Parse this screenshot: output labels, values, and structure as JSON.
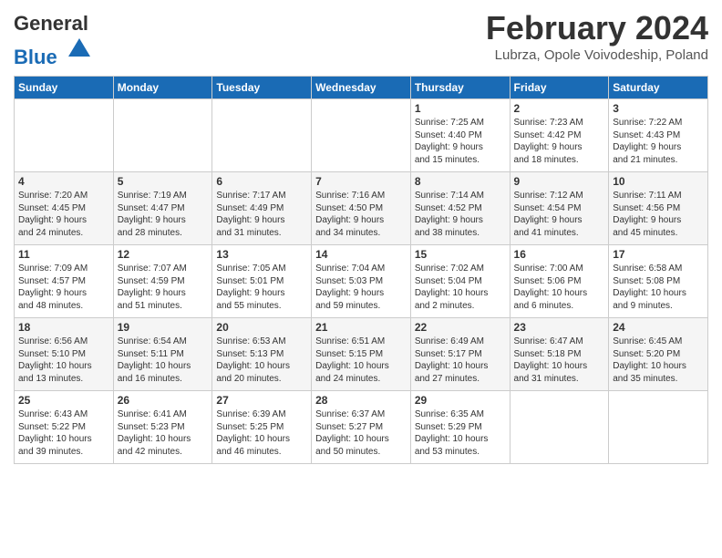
{
  "header": {
    "logo_general": "General",
    "logo_blue": "Blue",
    "month_title": "February 2024",
    "location": "Lubrza, Opole Voivodeship, Poland"
  },
  "weekdays": [
    "Sunday",
    "Monday",
    "Tuesday",
    "Wednesday",
    "Thursday",
    "Friday",
    "Saturday"
  ],
  "weeks": [
    [
      {
        "day": "",
        "content": ""
      },
      {
        "day": "",
        "content": ""
      },
      {
        "day": "",
        "content": ""
      },
      {
        "day": "",
        "content": ""
      },
      {
        "day": "1",
        "content": "Sunrise: 7:25 AM\nSunset: 4:40 PM\nDaylight: 9 hours\nand 15 minutes."
      },
      {
        "day": "2",
        "content": "Sunrise: 7:23 AM\nSunset: 4:42 PM\nDaylight: 9 hours\nand 18 minutes."
      },
      {
        "day": "3",
        "content": "Sunrise: 7:22 AM\nSunset: 4:43 PM\nDaylight: 9 hours\nand 21 minutes."
      }
    ],
    [
      {
        "day": "4",
        "content": "Sunrise: 7:20 AM\nSunset: 4:45 PM\nDaylight: 9 hours\nand 24 minutes."
      },
      {
        "day": "5",
        "content": "Sunrise: 7:19 AM\nSunset: 4:47 PM\nDaylight: 9 hours\nand 28 minutes."
      },
      {
        "day": "6",
        "content": "Sunrise: 7:17 AM\nSunset: 4:49 PM\nDaylight: 9 hours\nand 31 minutes."
      },
      {
        "day": "7",
        "content": "Sunrise: 7:16 AM\nSunset: 4:50 PM\nDaylight: 9 hours\nand 34 minutes."
      },
      {
        "day": "8",
        "content": "Sunrise: 7:14 AM\nSunset: 4:52 PM\nDaylight: 9 hours\nand 38 minutes."
      },
      {
        "day": "9",
        "content": "Sunrise: 7:12 AM\nSunset: 4:54 PM\nDaylight: 9 hours\nand 41 minutes."
      },
      {
        "day": "10",
        "content": "Sunrise: 7:11 AM\nSunset: 4:56 PM\nDaylight: 9 hours\nand 45 minutes."
      }
    ],
    [
      {
        "day": "11",
        "content": "Sunrise: 7:09 AM\nSunset: 4:57 PM\nDaylight: 9 hours\nand 48 minutes."
      },
      {
        "day": "12",
        "content": "Sunrise: 7:07 AM\nSunset: 4:59 PM\nDaylight: 9 hours\nand 51 minutes."
      },
      {
        "day": "13",
        "content": "Sunrise: 7:05 AM\nSunset: 5:01 PM\nDaylight: 9 hours\nand 55 minutes."
      },
      {
        "day": "14",
        "content": "Sunrise: 7:04 AM\nSunset: 5:03 PM\nDaylight: 9 hours\nand 59 minutes."
      },
      {
        "day": "15",
        "content": "Sunrise: 7:02 AM\nSunset: 5:04 PM\nDaylight: 10 hours\nand 2 minutes."
      },
      {
        "day": "16",
        "content": "Sunrise: 7:00 AM\nSunset: 5:06 PM\nDaylight: 10 hours\nand 6 minutes."
      },
      {
        "day": "17",
        "content": "Sunrise: 6:58 AM\nSunset: 5:08 PM\nDaylight: 10 hours\nand 9 minutes."
      }
    ],
    [
      {
        "day": "18",
        "content": "Sunrise: 6:56 AM\nSunset: 5:10 PM\nDaylight: 10 hours\nand 13 minutes."
      },
      {
        "day": "19",
        "content": "Sunrise: 6:54 AM\nSunset: 5:11 PM\nDaylight: 10 hours\nand 16 minutes."
      },
      {
        "day": "20",
        "content": "Sunrise: 6:53 AM\nSunset: 5:13 PM\nDaylight: 10 hours\nand 20 minutes."
      },
      {
        "day": "21",
        "content": "Sunrise: 6:51 AM\nSunset: 5:15 PM\nDaylight: 10 hours\nand 24 minutes."
      },
      {
        "day": "22",
        "content": "Sunrise: 6:49 AM\nSunset: 5:17 PM\nDaylight: 10 hours\nand 27 minutes."
      },
      {
        "day": "23",
        "content": "Sunrise: 6:47 AM\nSunset: 5:18 PM\nDaylight: 10 hours\nand 31 minutes."
      },
      {
        "day": "24",
        "content": "Sunrise: 6:45 AM\nSunset: 5:20 PM\nDaylight: 10 hours\nand 35 minutes."
      }
    ],
    [
      {
        "day": "25",
        "content": "Sunrise: 6:43 AM\nSunset: 5:22 PM\nDaylight: 10 hours\nand 39 minutes."
      },
      {
        "day": "26",
        "content": "Sunrise: 6:41 AM\nSunset: 5:23 PM\nDaylight: 10 hours\nand 42 minutes."
      },
      {
        "day": "27",
        "content": "Sunrise: 6:39 AM\nSunset: 5:25 PM\nDaylight: 10 hours\nand 46 minutes."
      },
      {
        "day": "28",
        "content": "Sunrise: 6:37 AM\nSunset: 5:27 PM\nDaylight: 10 hours\nand 50 minutes."
      },
      {
        "day": "29",
        "content": "Sunrise: 6:35 AM\nSunset: 5:29 PM\nDaylight: 10 hours\nand 53 minutes."
      },
      {
        "day": "",
        "content": ""
      },
      {
        "day": "",
        "content": ""
      }
    ]
  ]
}
